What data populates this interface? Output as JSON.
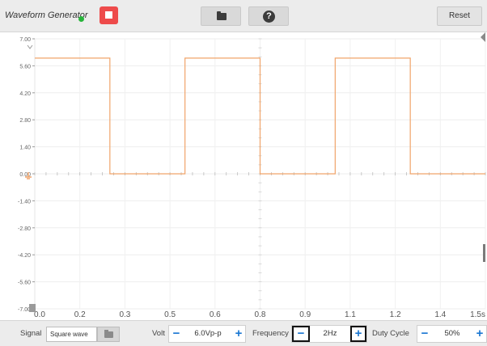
{
  "header": {
    "title": "Waveform Generator",
    "reset_label": "Reset"
  },
  "plot": {
    "y_ticks": [
      "7.00",
      "5.60",
      "4.20",
      "2.80",
      "1.40",
      "0.00",
      "-1.40",
      "-2.80",
      "-4.20",
      "-5.60",
      "-7.00"
    ],
    "x_ticks": [
      "0.0",
      "0.2",
      "0.3",
      "0.5",
      "0.6",
      "0.8",
      "0.9",
      "1.1",
      "1.2",
      "1.4",
      "1.5s"
    ],
    "trace_color": "#f0a46a",
    "waveform": {
      "type": "square",
      "high_v": 6.0,
      "low_v": 0.0,
      "transitions_s": [
        0.0,
        0.25,
        0.5,
        0.75,
        1.0,
        1.25,
        1.5
      ],
      "start_level": "high"
    }
  },
  "controls": {
    "signal_label": "Signal",
    "signal_value": "Square wave",
    "volt_label": "Volt",
    "volt_value": "6.0Vp-p",
    "freq_label": "Frequency",
    "freq_value": "2Hz",
    "duty_label": "Duty Cycle",
    "duty_value": "50%",
    "minus": "−",
    "plus": "+"
  }
}
